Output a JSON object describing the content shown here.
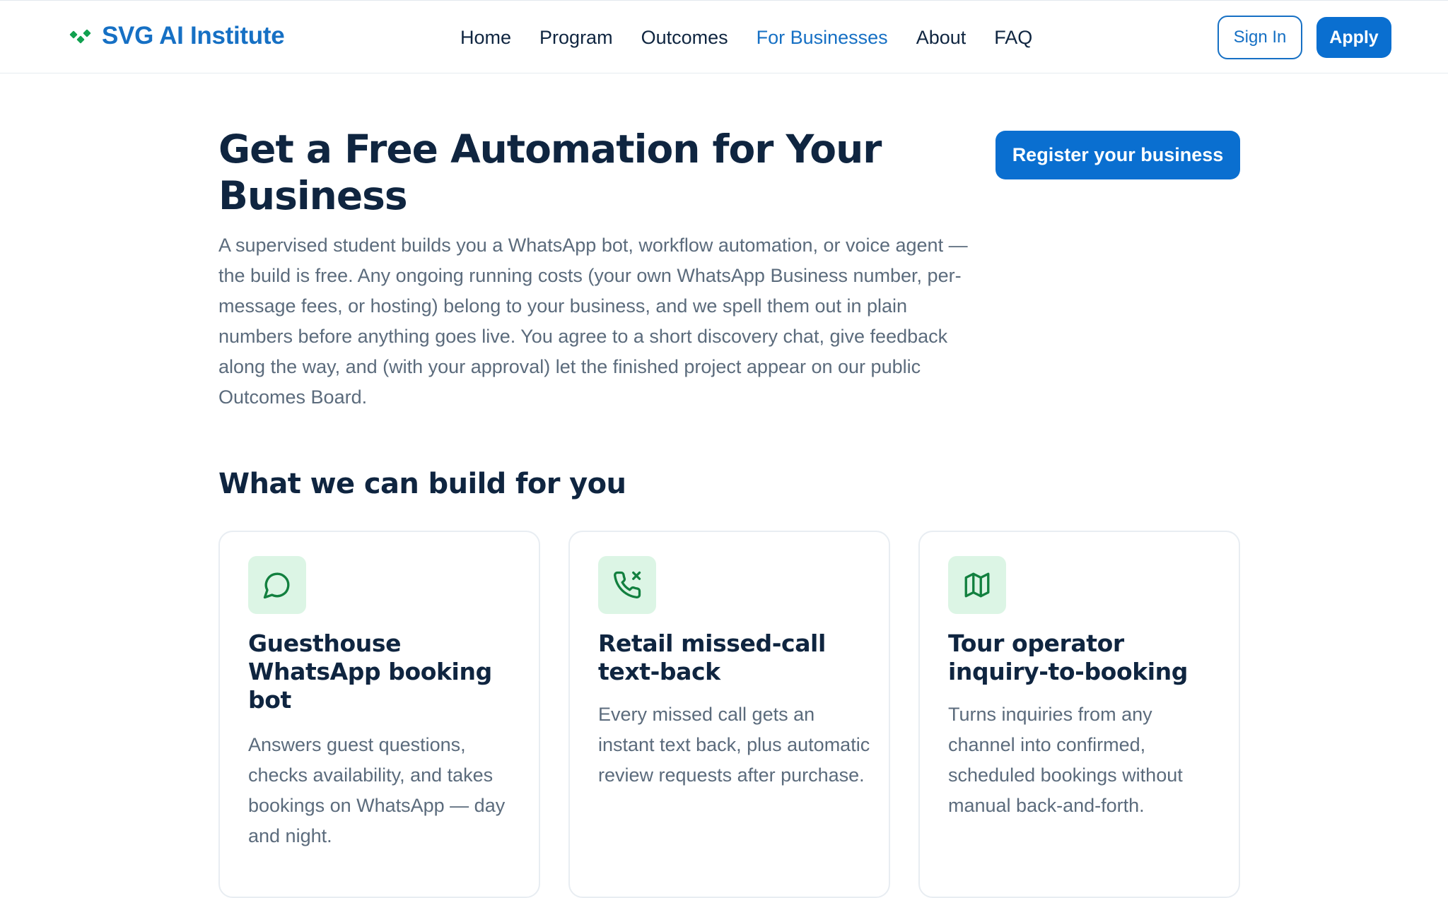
{
  "header": {
    "brand_name": "SVG AI Institute",
    "nav": [
      {
        "label": "Home",
        "active": false
      },
      {
        "label": "Program",
        "active": false
      },
      {
        "label": "Outcomes",
        "active": false
      },
      {
        "label": "For Businesses",
        "active": true
      },
      {
        "label": "About",
        "active": false
      },
      {
        "label": "FAQ",
        "active": false
      }
    ],
    "sign_in_label": "Sign In",
    "apply_label": "Apply"
  },
  "hero": {
    "title": "Get a Free Automation for Your Business",
    "register_label": "Register your business",
    "description": "A supervised student builds you a WhatsApp bot, workflow automation, or voice agent — the build is free. Any ongoing running costs (your own WhatsApp Business number, per-message fees, or hosting) belong to your business, and we spell them out in plain numbers before anything goes live. You agree to a short discovery chat, give feedback along the way, and (with your approval) let the finished project appear on our public Outcomes Board."
  },
  "section": {
    "title": "What we can build for you",
    "cards": [
      {
        "icon": "chat-bubble-icon",
        "title": "Guesthouse WhatsApp booking bot",
        "body": "Answers guest questions, checks availability, and takes bookings on WhatsApp — day and night."
      },
      {
        "icon": "phone-missed-icon",
        "title": "Retail missed-call text-back",
        "body": "Every missed call gets an instant text back, plus automatic review requests after purchase."
      },
      {
        "icon": "map-icon",
        "title": "Tour operator inquiry-to-booking",
        "body": "Turns inquiries from any channel into confirmed, scheduled bookings without manual back-and-forth."
      }
    ]
  },
  "colors": {
    "brand_blue": "#1670c4",
    "button_blue": "#0a6fd0",
    "brand_green": "#12a150",
    "icon_bg": "#dcf5e5",
    "heading": "#0f2540",
    "body_text": "#5b6b7c"
  }
}
